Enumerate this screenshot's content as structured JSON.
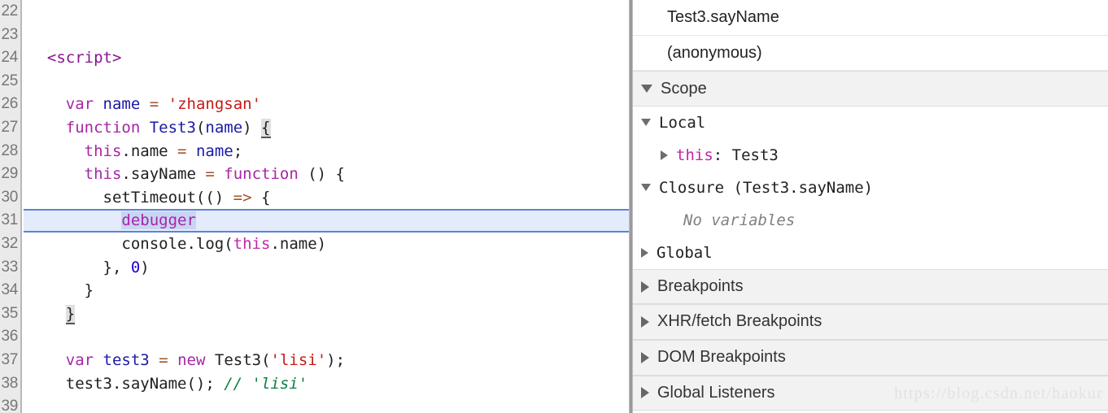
{
  "editor": {
    "first_line_number": 22,
    "execution_line": 31,
    "lines": [
      {
        "n": 22,
        "text": ""
      },
      {
        "n": 23,
        "text": ""
      },
      {
        "n": 24,
        "text": "<script>"
      },
      {
        "n": 25,
        "text": ""
      },
      {
        "n": 26,
        "text": "  var name = 'zhangsan'"
      },
      {
        "n": 27,
        "text": "  function Test3(name) {"
      },
      {
        "n": 28,
        "text": "    this.name = name;"
      },
      {
        "n": 29,
        "text": "    this.sayName = function () {"
      },
      {
        "n": 30,
        "text": "      setTimeout(() => {"
      },
      {
        "n": 31,
        "text": "        debugger"
      },
      {
        "n": 32,
        "text": "        console.log(this.name)"
      },
      {
        "n": 33,
        "text": "      }, 0)"
      },
      {
        "n": 34,
        "text": "    }"
      },
      {
        "n": 35,
        "text": "  }"
      },
      {
        "n": 36,
        "text": ""
      },
      {
        "n": 37,
        "text": "  var test3 = new Test3('lisi');"
      },
      {
        "n": 38,
        "text": "  test3.sayName(); // 'lisi'"
      },
      {
        "n": 39,
        "text": ""
      }
    ]
  },
  "sidebar": {
    "call_stack": [
      {
        "label": "Test3.sayName"
      },
      {
        "label": "(anonymous)"
      }
    ],
    "scope_header": "Scope",
    "scope": [
      {
        "label": "Local",
        "expanded": true
      },
      {
        "key": "this",
        "separator": ":",
        "value": "Test3"
      },
      {
        "label": "Closure (Test3.sayName)",
        "expanded": true
      },
      {
        "label": "No variables"
      },
      {
        "label": "Global",
        "expanded": false
      }
    ],
    "accordions": [
      {
        "label": "Breakpoints"
      },
      {
        "label": "XHR/fetch Breakpoints"
      },
      {
        "label": "DOM Breakpoints"
      },
      {
        "label": "Global Listeners"
      }
    ]
  },
  "watermark": {
    "text": "https://blog.csdn.net/haokur"
  },
  "colors": {
    "exec_line_bg": "#e4ebfb",
    "exec_line_border": "#5b84d6",
    "gutter_bg": "#eaeaea",
    "section_bg": "#f2f2f2",
    "keyword": "#a626a4",
    "string": "#c41a16",
    "number": "#1c00cf",
    "comment": "#0b8043",
    "operator": "#a0522d",
    "identifier": "#1a1aa6"
  }
}
